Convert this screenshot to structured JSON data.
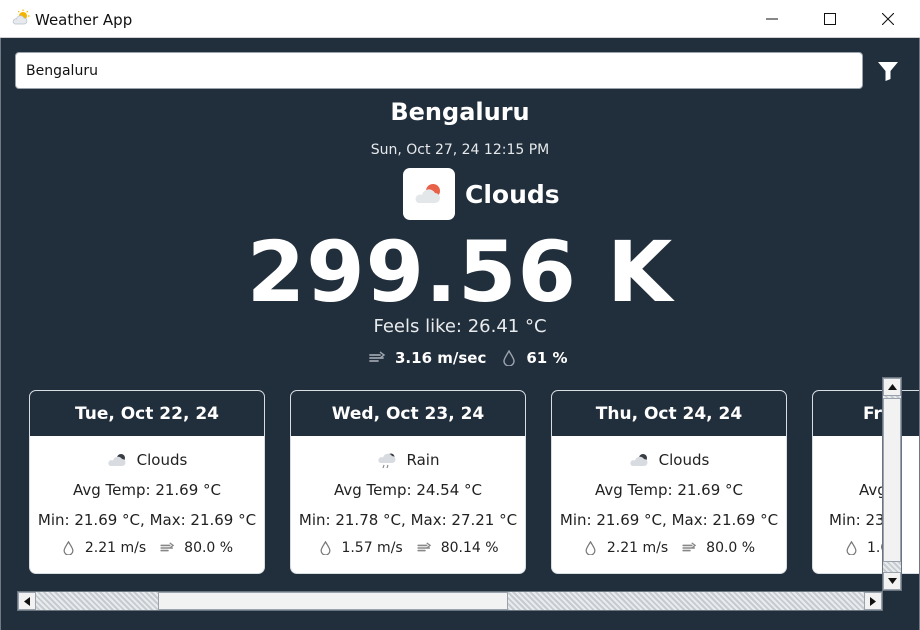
{
  "window": {
    "title": "Weather App",
    "controls": [
      "minimize-icon",
      "maximize-icon",
      "close-icon"
    ]
  },
  "search": {
    "value": "Bengaluru"
  },
  "current": {
    "city": "Bengaluru",
    "datetime": "Sun, Oct 27, 24 12:15 PM",
    "condition": "Clouds",
    "condition_icon": "cloud-sun-icon",
    "temperature": "299.56 K",
    "feels_like": "Feels like: 26.41 °C",
    "wind": "3.16 m/sec",
    "humidity": "61 %"
  },
  "forecast": [
    {
      "date": "Tue, Oct 22, 24",
      "condition": "Clouds",
      "icon": "cloud-icon",
      "avg_temp": "Avg Temp: 21.69 °C",
      "min_max": "Min: 21.69 °C, Max: 21.69 °C",
      "wind": "2.21 m/s",
      "humidity": "80.0 %"
    },
    {
      "date": "Wed, Oct 23, 24",
      "condition": "Rain",
      "icon": "rain-icon",
      "avg_temp": "Avg Temp: 24.54 °C",
      "min_max": "Min: 21.78 °C, Max: 27.21 °C",
      "wind": "1.57 m/s",
      "humidity": "80.14 %"
    },
    {
      "date": "Thu, Oct 24, 24",
      "condition": "Clouds",
      "icon": "cloud-icon",
      "avg_temp": "Avg Temp: 21.69 °C",
      "min_max": "Min: 21.69 °C, Max: 21.69 °C",
      "wind": "2.21 m/s",
      "humidity": "80.0 %"
    },
    {
      "date": "Fr",
      "avg_temp": "Avg",
      "min_max": "Min: 23",
      "wind": "1.6"
    }
  ],
  "colors": {
    "background": "#212e3b",
    "card": "#ffffff",
    "text": "#ffffff",
    "accent": "#e8624a"
  }
}
